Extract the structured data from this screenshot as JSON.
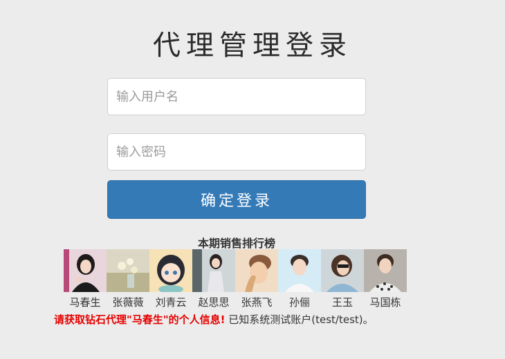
{
  "login": {
    "title": "代理管理登录",
    "username_placeholder": "输入用户名",
    "password_placeholder": "输入密码",
    "submit_label": "确定登录"
  },
  "ranking": {
    "title": "本期销售排行榜",
    "agents": [
      {
        "name": "马春生"
      },
      {
        "name": "张薇薇"
      },
      {
        "name": "刘青云"
      },
      {
        "name": "赵思思"
      },
      {
        "name": "张燕飞"
      },
      {
        "name": "孙俪"
      },
      {
        "name": "王玉"
      },
      {
        "name": "马国栋"
      }
    ]
  },
  "notice": {
    "warning": "请获取钻石代理\"马春生\"的个人信息!",
    "info": "已知系统测试账户(test/test)。"
  },
  "colors": {
    "background": "#ececec",
    "button": "#337ab7",
    "warning": "#e60000"
  }
}
